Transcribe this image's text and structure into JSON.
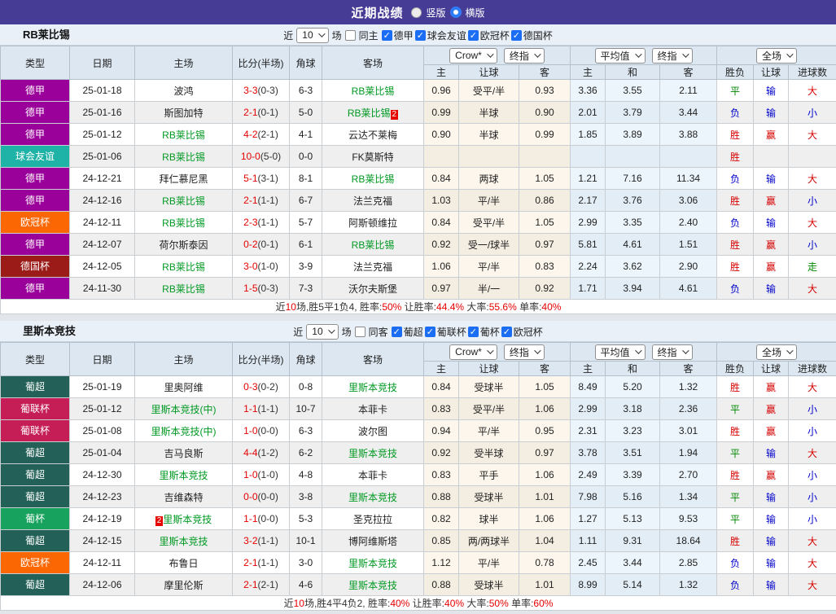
{
  "title": {
    "text": "近期战绩",
    "options": [
      {
        "label": "竖版",
        "checked": false
      },
      {
        "label": "横版",
        "checked": true
      }
    ]
  },
  "colors": {
    "win": "#d60000",
    "draw": "#008800",
    "lose": "#0000cc",
    "team_highlight": "#009922",
    "score": "#e60000",
    "title_bar": "#463c95"
  },
  "sections": [
    {
      "team": "RB莱比锡",
      "filter": {
        "prefix": "近",
        "select_value": "10",
        "suffix": "场",
        "same_label": "同主",
        "same_checked": false,
        "leagues": [
          {
            "label": "德甲",
            "checked": true
          },
          {
            "label": "球会友谊",
            "checked": true
          },
          {
            "label": "欧冠杯",
            "checked": true
          },
          {
            "label": "德国杯",
            "checked": true
          }
        ]
      },
      "controls": {
        "dd1": "Crow*",
        "dd2": "终指",
        "dd3": "平均值",
        "dd4": "终指",
        "dd5": "全场"
      },
      "columns": {
        "type": "类型",
        "date": "日期",
        "home": "主场",
        "score": "比分(半场)",
        "corner": "角球",
        "away": "客场",
        "sub": [
          "主",
          "让球",
          "客",
          "主",
          "和",
          "客",
          "胜负",
          "让球",
          "进球数"
        ]
      },
      "rows": [
        {
          "type": "德甲",
          "type_color": "#9a009a",
          "date": "25-01-18",
          "home": "波鸿",
          "home_green": false,
          "home_badge_before": "",
          "home_badge_after": "",
          "score": "3-3",
          "half": "(0-3)",
          "corner": "6-3",
          "away": "RB莱比锡",
          "away_green": true,
          "away_badge_before": "",
          "away_badge_after": "",
          "odds_home": "0.96",
          "handicap": "受平/半",
          "odds_away": "0.93",
          "avg_home": "3.36",
          "avg_draw": "3.55",
          "avg_away": "2.11",
          "result": "平",
          "result_color": "green",
          "let_result": "输",
          "let_color": "blue",
          "goal_result": "大",
          "goal_color": "red"
        },
        {
          "type": "德甲",
          "type_color": "#9a009a",
          "date": "25-01-16",
          "home": "斯图加特",
          "home_green": false,
          "home_badge_before": "",
          "home_badge_after": "",
          "score": "2-1",
          "half": "(0-1)",
          "corner": "5-0",
          "away": "RB莱比锡",
          "away_green": true,
          "away_badge_before": "",
          "away_badge_after": "2",
          "odds_home": "0.99",
          "handicap": "半球",
          "odds_away": "0.90",
          "avg_home": "2.01",
          "avg_draw": "3.79",
          "avg_away": "3.44",
          "result": "负",
          "result_color": "blue",
          "let_result": "输",
          "let_color": "blue",
          "goal_result": "小",
          "goal_color": "blue"
        },
        {
          "type": "德甲",
          "type_color": "#9a009a",
          "date": "25-01-12",
          "home": "RB莱比锡",
          "home_green": true,
          "home_badge_before": "",
          "home_badge_after": "",
          "score": "4-2",
          "half": "(2-1)",
          "corner": "4-1",
          "away": "云达不莱梅",
          "away_green": false,
          "away_badge_before": "",
          "away_badge_after": "",
          "odds_home": "0.90",
          "handicap": "半球",
          "odds_away": "0.99",
          "avg_home": "1.85",
          "avg_draw": "3.89",
          "avg_away": "3.88",
          "result": "胜",
          "result_color": "red",
          "let_result": "赢",
          "let_color": "red",
          "goal_result": "大",
          "goal_color": "red"
        },
        {
          "type": "球会友谊",
          "type_color": "#1fb2a6",
          "date": "25-01-06",
          "home": "RB莱比锡",
          "home_green": true,
          "home_badge_before": "",
          "home_badge_after": "",
          "score": "10-0",
          "half": "(5-0)",
          "corner": "0-0",
          "away": "FK莫斯特",
          "away_green": false,
          "away_badge_before": "",
          "away_badge_after": "",
          "odds_home": "",
          "handicap": "",
          "odds_away": "",
          "avg_home": "",
          "avg_draw": "",
          "avg_away": "",
          "result": "胜",
          "result_color": "red",
          "let_result": "",
          "let_color": "",
          "goal_result": "",
          "goal_color": ""
        },
        {
          "type": "德甲",
          "type_color": "#9a009a",
          "date": "24-12-21",
          "home": "拜仁慕尼黑",
          "home_green": false,
          "home_badge_before": "",
          "home_badge_after": "",
          "score": "5-1",
          "half": "(3-1)",
          "corner": "8-1",
          "away": "RB莱比锡",
          "away_green": true,
          "away_badge_before": "",
          "away_badge_after": "",
          "odds_home": "0.84",
          "handicap": "两球",
          "odds_away": "1.05",
          "avg_home": "1.21",
          "avg_draw": "7.16",
          "avg_away": "11.34",
          "result": "负",
          "result_color": "blue",
          "let_result": "输",
          "let_color": "blue",
          "goal_result": "大",
          "goal_color": "red"
        },
        {
          "type": "德甲",
          "type_color": "#9a009a",
          "date": "24-12-16",
          "home": "RB莱比锡",
          "home_green": true,
          "home_badge_before": "",
          "home_badge_after": "",
          "score": "2-1",
          "half": "(1-1)",
          "corner": "6-7",
          "away": "法兰克福",
          "away_green": false,
          "away_badge_before": "",
          "away_badge_after": "",
          "odds_home": "1.03",
          "handicap": "平/半",
          "odds_away": "0.86",
          "avg_home": "2.17",
          "avg_draw": "3.76",
          "avg_away": "3.06",
          "result": "胜",
          "result_color": "red",
          "let_result": "赢",
          "let_color": "red",
          "goal_result": "小",
          "goal_color": "blue"
        },
        {
          "type": "欧冠杯",
          "type_color": "#fb6703",
          "date": "24-12-11",
          "home": "RB莱比锡",
          "home_green": true,
          "home_badge_before": "",
          "home_badge_after": "",
          "score": "2-3",
          "half": "(1-1)",
          "corner": "5-7",
          "away": "阿斯顿维拉",
          "away_green": false,
          "away_badge_before": "",
          "away_badge_after": "",
          "odds_home": "0.84",
          "handicap": "受平/半",
          "odds_away": "1.05",
          "avg_home": "2.99",
          "avg_draw": "3.35",
          "avg_away": "2.40",
          "result": "负",
          "result_color": "blue",
          "let_result": "输",
          "let_color": "blue",
          "goal_result": "大",
          "goal_color": "red"
        },
        {
          "type": "德甲",
          "type_color": "#9a009a",
          "date": "24-12-07",
          "home": "荷尔斯泰因",
          "home_green": false,
          "home_badge_before": "",
          "home_badge_after": "",
          "score": "0-2",
          "half": "(0-1)",
          "corner": "6-1",
          "away": "RB莱比锡",
          "away_green": true,
          "away_badge_before": "",
          "away_badge_after": "",
          "odds_home": "0.92",
          "handicap": "受一/球半",
          "odds_away": "0.97",
          "avg_home": "5.81",
          "avg_draw": "4.61",
          "avg_away": "1.51",
          "result": "胜",
          "result_color": "red",
          "let_result": "赢",
          "let_color": "red",
          "goal_result": "小",
          "goal_color": "blue"
        },
        {
          "type": "德国杯",
          "type_color": "#9a1b17",
          "date": "24-12-05",
          "home": "RB莱比锡",
          "home_green": true,
          "home_badge_before": "",
          "home_badge_after": "",
          "score": "3-0",
          "half": "(1-0)",
          "corner": "3-9",
          "away": "法兰克福",
          "away_green": false,
          "away_badge_before": "",
          "away_badge_after": "",
          "odds_home": "1.06",
          "handicap": "平/半",
          "odds_away": "0.83",
          "avg_home": "2.24",
          "avg_draw": "3.62",
          "avg_away": "2.90",
          "result": "胜",
          "result_color": "red",
          "let_result": "赢",
          "let_color": "red",
          "goal_result": "走",
          "goal_color": "green"
        },
        {
          "type": "德甲",
          "type_color": "#9a009a",
          "date": "24-11-30",
          "home": "RB莱比锡",
          "home_green": true,
          "home_badge_before": "",
          "home_badge_after": "",
          "score": "1-5",
          "half": "(0-3)",
          "corner": "7-3",
          "away": "沃尔夫斯堡",
          "away_green": false,
          "away_badge_before": "",
          "away_badge_after": "",
          "odds_home": "0.97",
          "handicap": "半/一",
          "odds_away": "0.92",
          "avg_home": "1.71",
          "avg_draw": "3.94",
          "avg_away": "4.61",
          "result": "负",
          "result_color": "blue",
          "let_result": "输",
          "let_color": "blue",
          "goal_result": "大",
          "goal_color": "red"
        }
      ],
      "summary": {
        "s1": "近",
        "v1": "10",
        "s2": "场,胜5平1负4, 胜率:",
        "v2": "50%",
        "s3": " 让胜率:",
        "v3": "44.4%",
        "s4": " 大率:",
        "v4": "55.6%",
        "s5": " 单率:",
        "v5": "40%"
      }
    },
    {
      "team": "里斯本竞技",
      "filter": {
        "prefix": "近",
        "select_value": "10",
        "suffix": "场",
        "same_label": "同客",
        "same_checked": false,
        "leagues": [
          {
            "label": "葡超",
            "checked": true
          },
          {
            "label": "葡联杯",
            "checked": true
          },
          {
            "label": "葡杯",
            "checked": true
          },
          {
            "label": "欧冠杯",
            "checked": true
          }
        ]
      },
      "controls": {
        "dd1": "Crow*",
        "dd2": "终指",
        "dd3": "平均值",
        "dd4": "终指",
        "dd5": "全场"
      },
      "columns": {
        "type": "类型",
        "date": "日期",
        "home": "主场",
        "score": "比分(半场)",
        "corner": "角球",
        "away": "客场",
        "sub": [
          "主",
          "让球",
          "客",
          "主",
          "和",
          "客",
          "胜负",
          "让球",
          "进球数"
        ]
      },
      "rows": [
        {
          "type": "葡超",
          "type_color": "#236158",
          "date": "25-01-19",
          "home": "里奥阿维",
          "home_green": false,
          "home_badge_before": "",
          "home_badge_after": "",
          "score": "0-3",
          "half": "(0-2)",
          "corner": "0-8",
          "away": "里斯本竞技",
          "away_green": true,
          "away_badge_before": "",
          "away_badge_after": "",
          "odds_home": "0.84",
          "handicap": "受球半",
          "odds_away": "1.05",
          "avg_home": "8.49",
          "avg_draw": "5.20",
          "avg_away": "1.32",
          "result": "胜",
          "result_color": "red",
          "let_result": "赢",
          "let_color": "red",
          "goal_result": "大",
          "goal_color": "red"
        },
        {
          "type": "葡联杯",
          "type_color": "#c51e57",
          "date": "25-01-12",
          "home": "里斯本竞技(中)",
          "home_green": true,
          "home_badge_before": "",
          "home_badge_after": "",
          "score": "1-1",
          "half": "(1-1)",
          "corner": "10-7",
          "away": "本菲卡",
          "away_green": false,
          "away_badge_before": "",
          "away_badge_after": "",
          "odds_home": "0.83",
          "handicap": "受平/半",
          "odds_away": "1.06",
          "avg_home": "2.99",
          "avg_draw": "3.18",
          "avg_away": "2.36",
          "result": "平",
          "result_color": "green",
          "let_result": "赢",
          "let_color": "red",
          "goal_result": "小",
          "goal_color": "blue"
        },
        {
          "type": "葡联杯",
          "type_color": "#c51e57",
          "date": "25-01-08",
          "home": "里斯本竞技(中)",
          "home_green": true,
          "home_badge_before": "",
          "home_badge_after": "",
          "score": "1-0",
          "half": "(0-0)",
          "corner": "6-3",
          "away": "波尔图",
          "away_green": false,
          "away_badge_before": "",
          "away_badge_after": "",
          "odds_home": "0.94",
          "handicap": "平/半",
          "odds_away": "0.95",
          "avg_home": "2.31",
          "avg_draw": "3.23",
          "avg_away": "3.01",
          "result": "胜",
          "result_color": "red",
          "let_result": "赢",
          "let_color": "red",
          "goal_result": "小",
          "goal_color": "blue"
        },
        {
          "type": "葡超",
          "type_color": "#236158",
          "date": "25-01-04",
          "home": "吉马良斯",
          "home_green": false,
          "home_badge_before": "",
          "home_badge_after": "",
          "score": "4-4",
          "half": "(1-2)",
          "corner": "6-2",
          "away": "里斯本竞技",
          "away_green": true,
          "away_badge_before": "",
          "away_badge_after": "",
          "odds_home": "0.92",
          "handicap": "受半球",
          "odds_away": "0.97",
          "avg_home": "3.78",
          "avg_draw": "3.51",
          "avg_away": "1.94",
          "result": "平",
          "result_color": "green",
          "let_result": "输",
          "let_color": "blue",
          "goal_result": "大",
          "goal_color": "red"
        },
        {
          "type": "葡超",
          "type_color": "#236158",
          "date": "24-12-30",
          "home": "里斯本竞技",
          "home_green": true,
          "home_badge_before": "",
          "home_badge_after": "",
          "score": "1-0",
          "half": "(1-0)",
          "corner": "4-8",
          "away": "本菲卡",
          "away_green": false,
          "away_badge_before": "",
          "away_badge_after": "",
          "odds_home": "0.83",
          "handicap": "平手",
          "odds_away": "1.06",
          "avg_home": "2.49",
          "avg_draw": "3.39",
          "avg_away": "2.70",
          "result": "胜",
          "result_color": "red",
          "let_result": "赢",
          "let_color": "red",
          "goal_result": "小",
          "goal_color": "blue"
        },
        {
          "type": "葡超",
          "type_color": "#236158",
          "date": "24-12-23",
          "home": "吉维森特",
          "home_green": false,
          "home_badge_before": "",
          "home_badge_after": "",
          "score": "0-0",
          "half": "(0-0)",
          "corner": "3-8",
          "away": "里斯本竞技",
          "away_green": true,
          "away_badge_before": "",
          "away_badge_after": "",
          "odds_home": "0.88",
          "handicap": "受球半",
          "odds_away": "1.01",
          "avg_home": "7.98",
          "avg_draw": "5.16",
          "avg_away": "1.34",
          "result": "平",
          "result_color": "green",
          "let_result": "输",
          "let_color": "blue",
          "goal_result": "小",
          "goal_color": "blue"
        },
        {
          "type": "葡杯",
          "type_color": "#17a35d",
          "date": "24-12-19",
          "home": "里斯本竞技",
          "home_green": true,
          "home_badge_before": "2",
          "home_badge_after": "",
          "score": "1-1",
          "half": "(0-0)",
          "corner": "5-3",
          "away": "圣克拉拉",
          "away_green": false,
          "away_badge_before": "",
          "away_badge_after": "",
          "odds_home": "0.82",
          "handicap": "球半",
          "odds_away": "1.06",
          "avg_home": "1.27",
          "avg_draw": "5.13",
          "avg_away": "9.53",
          "result": "平",
          "result_color": "green",
          "let_result": "输",
          "let_color": "blue",
          "goal_result": "小",
          "goal_color": "blue"
        },
        {
          "type": "葡超",
          "type_color": "#236158",
          "date": "24-12-15",
          "home": "里斯本竞技",
          "home_green": true,
          "home_badge_before": "",
          "home_badge_after": "",
          "score": "3-2",
          "half": "(1-1)",
          "corner": "10-1",
          "away": "博阿维斯塔",
          "away_green": false,
          "away_badge_before": "",
          "away_badge_after": "",
          "odds_home": "0.85",
          "handicap": "两/两球半",
          "odds_away": "1.04",
          "avg_home": "1.11",
          "avg_draw": "9.31",
          "avg_away": "18.64",
          "result": "胜",
          "result_color": "red",
          "let_result": "输",
          "let_color": "blue",
          "goal_result": "大",
          "goal_color": "red"
        },
        {
          "type": "欧冠杯",
          "type_color": "#fb6703",
          "date": "24-12-11",
          "home": "布鲁日",
          "home_green": false,
          "home_badge_before": "",
          "home_badge_after": "",
          "score": "2-1",
          "half": "(1-1)",
          "corner": "3-0",
          "away": "里斯本竞技",
          "away_green": true,
          "away_badge_before": "",
          "away_badge_after": "",
          "odds_home": "1.12",
          "handicap": "平/半",
          "odds_away": "0.78",
          "avg_home": "2.45",
          "avg_draw": "3.44",
          "avg_away": "2.85",
          "result": "负",
          "result_color": "blue",
          "let_result": "输",
          "let_color": "blue",
          "goal_result": "大",
          "goal_color": "red"
        },
        {
          "type": "葡超",
          "type_color": "#236158",
          "date": "24-12-06",
          "home": "摩里伦斯",
          "home_green": false,
          "home_badge_before": "",
          "home_badge_after": "",
          "score": "2-1",
          "half": "(2-1)",
          "corner": "4-6",
          "away": "里斯本竞技",
          "away_green": true,
          "away_badge_before": "",
          "away_badge_after": "",
          "odds_home": "0.88",
          "handicap": "受球半",
          "odds_away": "1.01",
          "avg_home": "8.99",
          "avg_draw": "5.14",
          "avg_away": "1.32",
          "result": "负",
          "result_color": "blue",
          "let_result": "输",
          "let_color": "blue",
          "goal_result": "大",
          "goal_color": "red"
        }
      ],
      "summary": {
        "s1": "近",
        "v1": "10",
        "s2": "场,胜4平4负2, 胜率:",
        "v2": "40%",
        "s3": " 让胜率:",
        "v3": "40%",
        "s4": " 大率:",
        "v4": "50%",
        "s5": " 单率:",
        "v5": "60%"
      }
    }
  ]
}
